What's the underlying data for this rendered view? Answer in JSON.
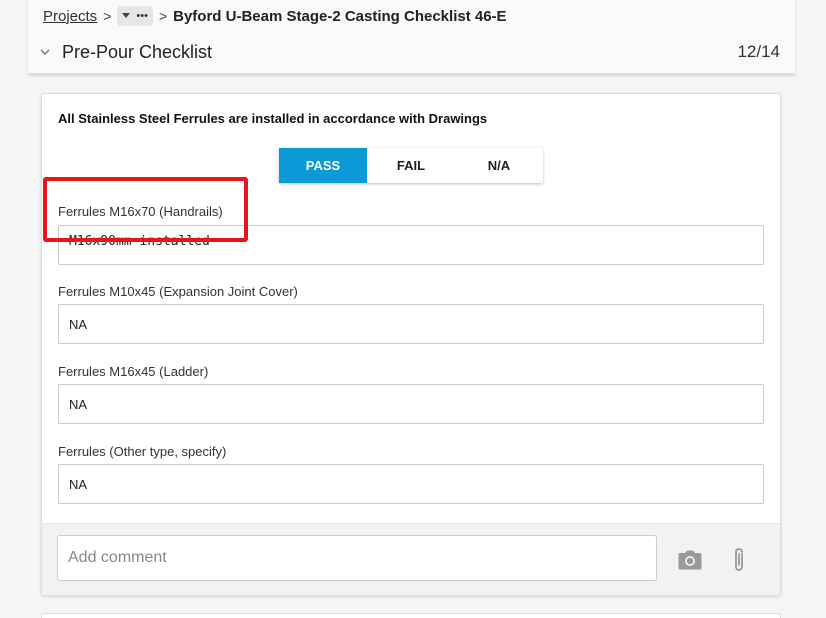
{
  "breadcrumb": {
    "root": "Projects",
    "separator": ">",
    "more": "•••",
    "current": "Byford U-Beam Stage-2 Casting Checklist 46-E"
  },
  "section": {
    "title": "Pre-Pour Checklist",
    "progress": "12/14"
  },
  "question": {
    "text": "All Stainless Steel Ferrules are installed in accordance with Drawings",
    "options": [
      {
        "label": "PASS",
        "selected": true
      },
      {
        "label": "FAIL",
        "selected": false
      },
      {
        "label": "N/A",
        "selected": false
      }
    ]
  },
  "fields": [
    {
      "label": "Ferrules M16x70 (Handrails)",
      "value": "M16x90mm installed"
    },
    {
      "label": "Ferrules M10x45 (Expansion Joint Cover)",
      "value": "NA"
    },
    {
      "label": "Ferrules M16x45 (Ladder)",
      "value": "NA"
    },
    {
      "label": "Ferrules (Other type, specify)",
      "value": "NA"
    }
  ],
  "comment": {
    "placeholder": "Add comment"
  },
  "colors": {
    "accent": "#0b9ad6",
    "highlight": "#e8141b"
  },
  "icons": {
    "section_toggle": "chevron-down-icon",
    "camera": "camera-icon",
    "attach": "paperclip-icon",
    "dropdown": "caret-down-icon"
  }
}
